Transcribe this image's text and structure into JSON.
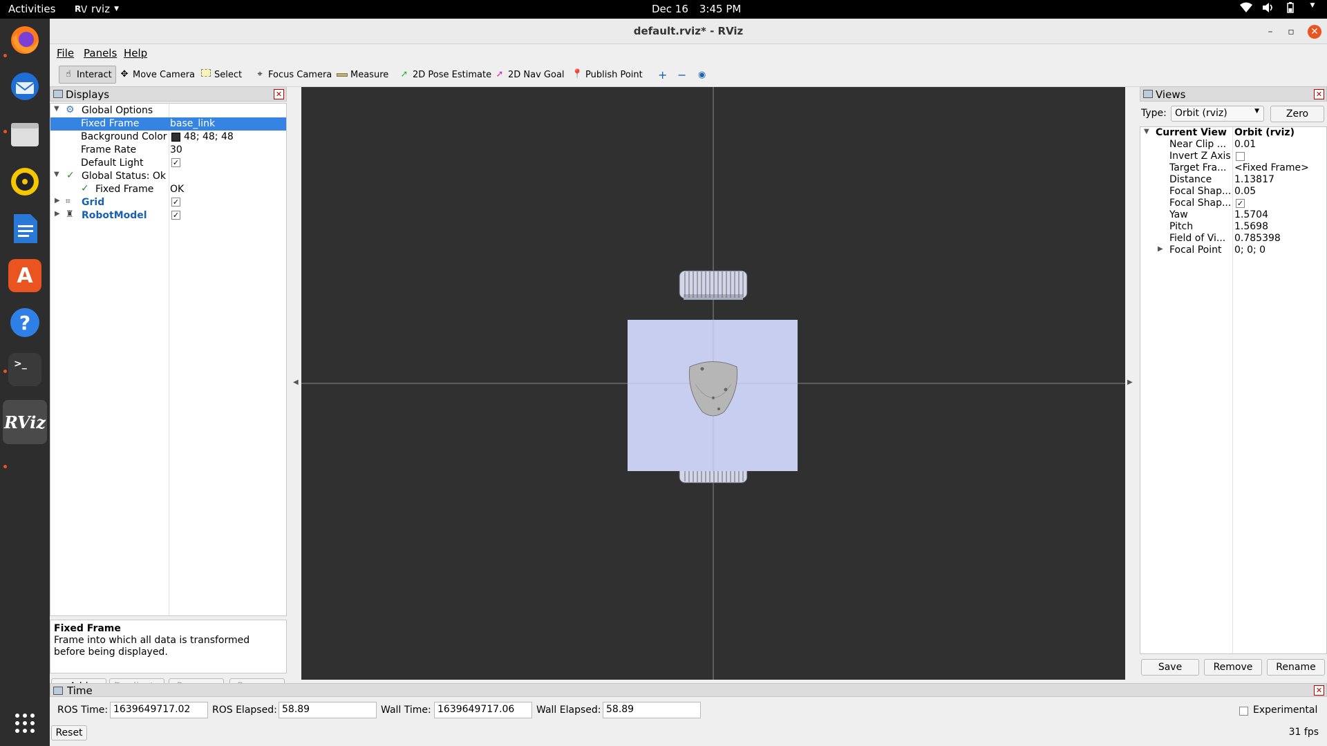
{
  "topbar": {
    "activities": "Activities",
    "app_name": "rviz",
    "app_logo": "R\\/",
    "date": "Dec 16",
    "time": "3:45 PM"
  },
  "window": {
    "title": "default.rviz* - RViz"
  },
  "menu": {
    "file": "File",
    "panels": "Panels",
    "help": "Help"
  },
  "toolbar": {
    "interact": "Interact",
    "move_camera": "Move Camera",
    "select": "Select",
    "focus_camera": "Focus Camera",
    "measure": "Measure",
    "pose_estimate": "2D Pose Estimate",
    "nav_goal": "2D Nav Goal",
    "publish_point": "Publish Point"
  },
  "displays": {
    "title": "Displays",
    "rows": {
      "global_options": "Global Options",
      "fixed_frame_key": "Fixed Frame",
      "fixed_frame_val": "base_link",
      "bg_color_key": "Background Color",
      "bg_color_val": "48; 48; 48",
      "frame_rate_key": "Frame Rate",
      "frame_rate_val": "30",
      "default_light_key": "Default Light",
      "global_status": "Global Status: Ok",
      "status_fixed_frame_key": "Fixed Frame",
      "status_fixed_frame_val": "OK",
      "grid": "Grid",
      "robot_model": "RobotModel"
    },
    "description_title": "Fixed Frame",
    "description_text": "Frame into which all data is transformed before being displayed.",
    "buttons": {
      "add": "Add",
      "duplicate": "Duplicate",
      "remove": "Remove",
      "rename": "Rename"
    }
  },
  "views": {
    "title": "Views",
    "type_label": "Type:",
    "type_value": "Orbit (rviz)",
    "zero": "Zero",
    "current_view": "Current View",
    "current_view_val": "Orbit (rviz)",
    "props": [
      {
        "k": "Near Clip ...",
        "v": "0.01"
      },
      {
        "k": "Invert Z Axis",
        "v": ""
      },
      {
        "k": "Target Fra...",
        "v": "<Fixed Frame>"
      },
      {
        "k": "Distance",
        "v": "1.13817"
      },
      {
        "k": "Focal Shap...",
        "v": "0.05"
      },
      {
        "k": "Focal Shap...",
        "v": ""
      },
      {
        "k": "Yaw",
        "v": "1.5704"
      },
      {
        "k": "Pitch",
        "v": "1.5698"
      },
      {
        "k": "Field of Vi...",
        "v": "0.785398"
      },
      {
        "k": "Focal Point",
        "v": "0; 0; 0"
      }
    ],
    "buttons": {
      "save": "Save",
      "remove": "Remove",
      "rename": "Rename"
    }
  },
  "time": {
    "title": "Time",
    "ros_time_label": "ROS Time:",
    "ros_time": "1639649717.02",
    "ros_elapsed_label": "ROS Elapsed:",
    "ros_elapsed": "58.89",
    "wall_time_label": "Wall Time:",
    "wall_time": "1639649717.06",
    "wall_elapsed_label": "Wall Elapsed:",
    "wall_elapsed": "58.89",
    "experimental": "Experimental",
    "reset": "Reset",
    "fps": "31 fps"
  },
  "colors": {
    "accent": "#3584e4",
    "background": "#303030",
    "robot_base": "#c8cef0",
    "ubuntu_orange": "#e95420"
  }
}
